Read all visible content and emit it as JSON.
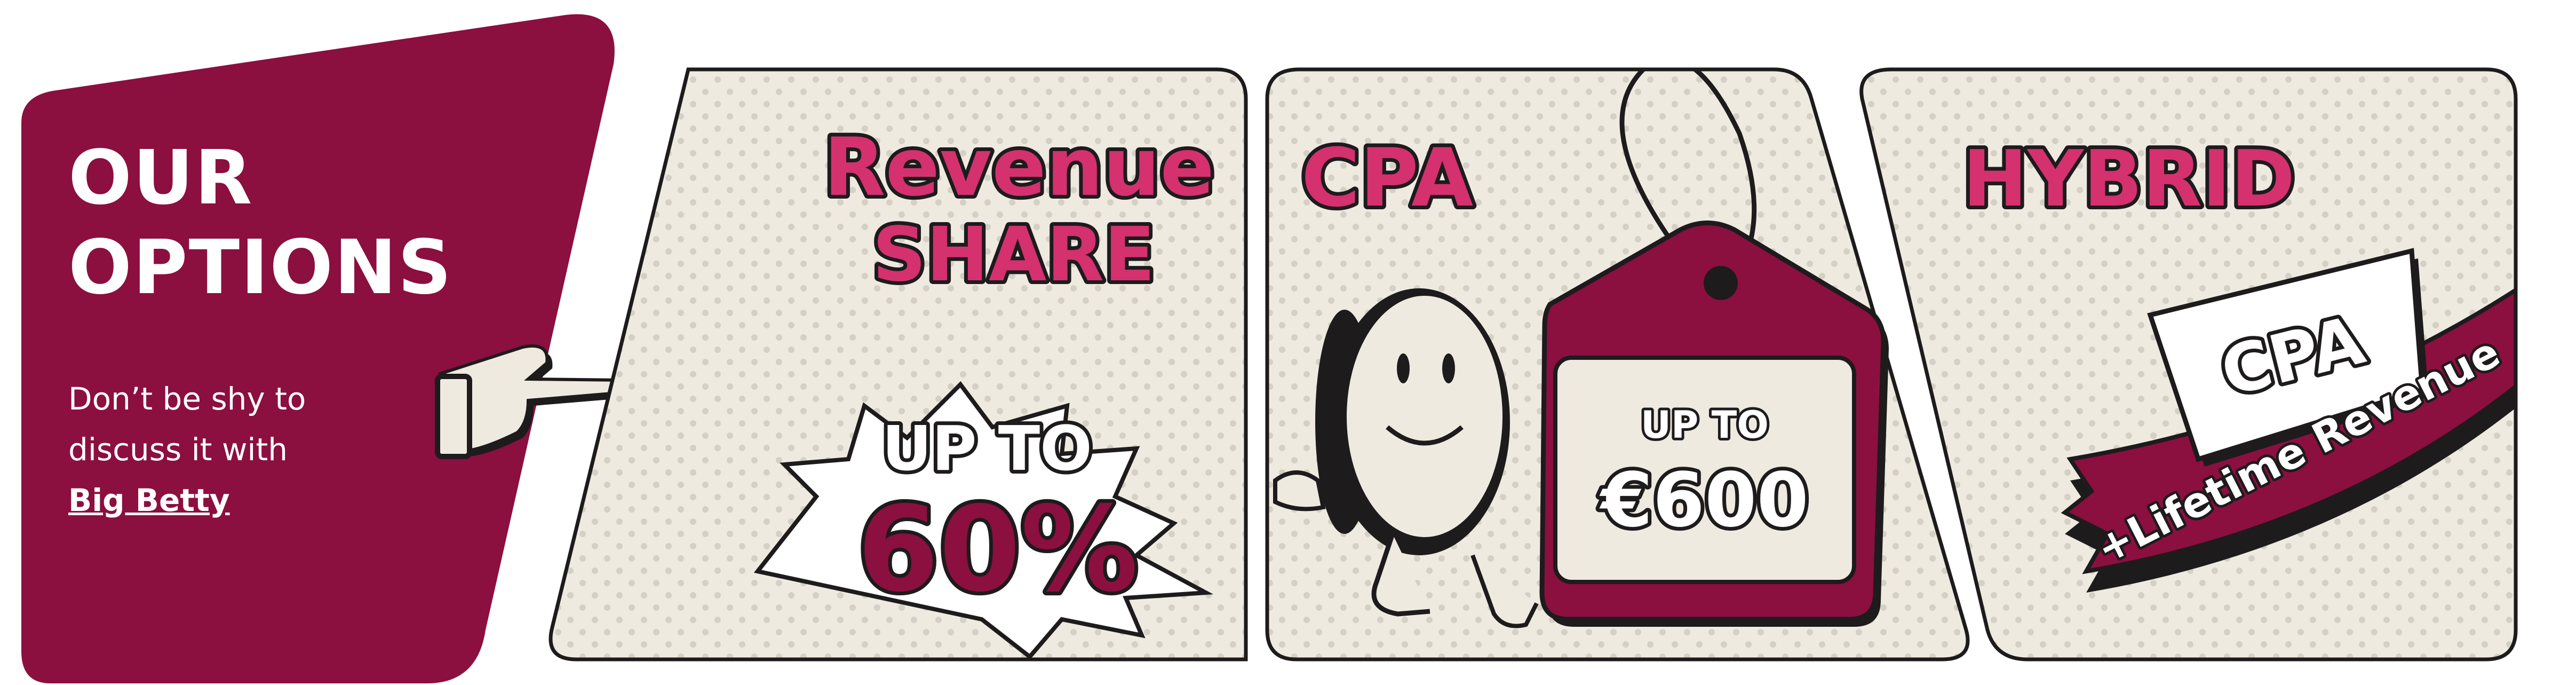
{
  "colors": {
    "brand": "#8b0f3f",
    "accent_pink": "#d4316e",
    "panel_bg": "#efeae0",
    "outline": "#1e1b1d",
    "white": "#ffffff",
    "dot": "#c9c3b8"
  },
  "intro": {
    "title_line1": "OUR",
    "title_line2": "OPTIONS",
    "sub_line1": "Don’t be shy to",
    "sub_line2": "discuss it with",
    "link_label": "Big Betty",
    "pointer_icon": "pointing-hand-icon"
  },
  "cards": {
    "revenue_share": {
      "title_line1": "Revenue",
      "title_line2": "SHARE",
      "burst_line1": "UP TO",
      "burst_line2": "60%"
    },
    "cpa": {
      "title": "CPA",
      "tag_line1": "UP TO",
      "tag_line2": "€600",
      "mascot_icon": "coin-mascot-icon",
      "tag_icon": "price-tag-icon"
    },
    "hybrid": {
      "title": "HYBRID",
      "sign_label": "CPA",
      "ribbon_label": "+Lifetime Revenue",
      "sign_icon": "sign-icon",
      "ribbon_icon": "ribbon-icon"
    }
  }
}
